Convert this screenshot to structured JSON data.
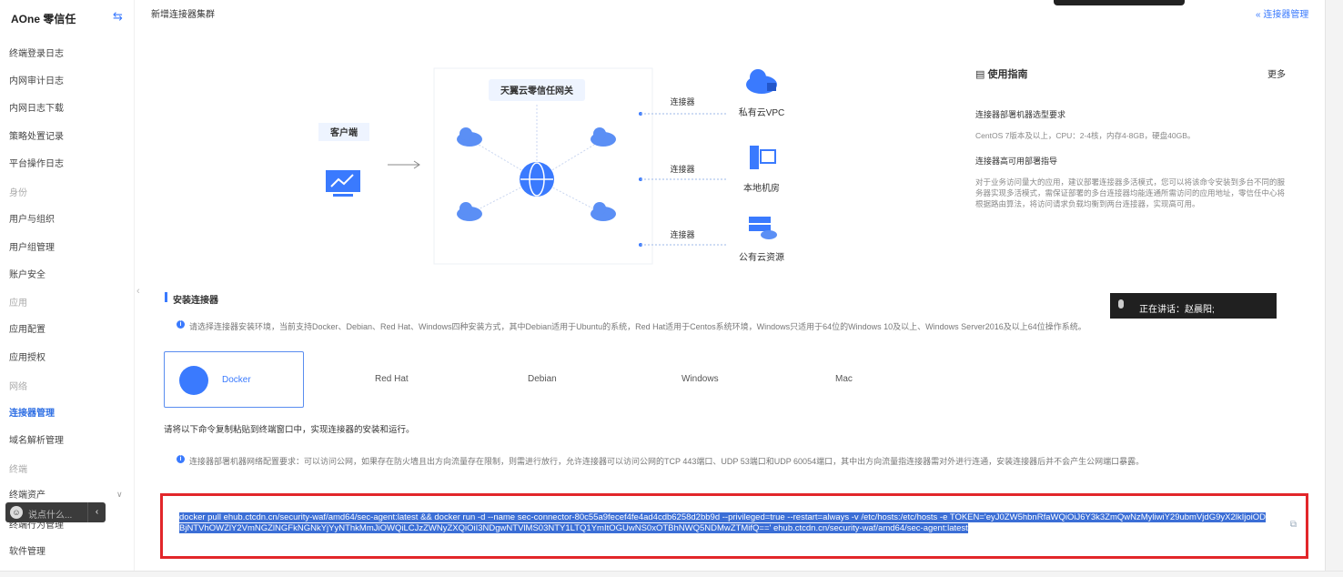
{
  "sidebar": {
    "brand": "AOne 零信任",
    "items": [
      {
        "label": "终端登录日志",
        "type": "item"
      },
      {
        "label": "内网审计日志",
        "type": "item"
      },
      {
        "label": "内网日志下载",
        "type": "item"
      },
      {
        "label": "策略处置记录",
        "type": "item"
      },
      {
        "label": "平台操作日志",
        "type": "item"
      },
      {
        "label": "身份",
        "type": "group"
      },
      {
        "label": "用户与组织",
        "type": "item"
      },
      {
        "label": "用户组管理",
        "type": "item"
      },
      {
        "label": "账户安全",
        "type": "item"
      },
      {
        "label": "应用",
        "type": "group"
      },
      {
        "label": "应用配置",
        "type": "item"
      },
      {
        "label": "应用授权",
        "type": "item"
      },
      {
        "label": "网络",
        "type": "group"
      },
      {
        "label": "连接器管理",
        "type": "active"
      },
      {
        "label": "域名解析管理",
        "type": "item"
      },
      {
        "label": "终端",
        "type": "group"
      },
      {
        "label": "终端资产",
        "type": "item"
      },
      {
        "label": "终端行为管理",
        "type": "item"
      },
      {
        "label": "软件管理",
        "type": "item"
      }
    ],
    "assist_placeholder": "说点什么..."
  },
  "header": {
    "title": "新增连接器集群",
    "breadcrumb": "« 连接器管理"
  },
  "diagram": {
    "client_label": "客户端",
    "gateway_label": "天翼云零信任网关",
    "connector_label": "连接器",
    "targets": [
      "私有云VPC",
      "本地机房",
      "公有云资源"
    ]
  },
  "guide": {
    "title": "使用指南",
    "more": "更多",
    "h1": "连接器部署机器选型要求",
    "p1": "CentOS 7版本及以上，CPU：2-4核，内存4-8GB，硬盘40GB。",
    "h2": "连接器高可用部署指导",
    "p2": "对于业务访问量大的应用，建议部署连接器多活模式，您可以将该命令安装到多台不同的服务器实现多活模式，需保证部署的多台连接器均能连通所需访问的应用地址，零信任中心将根据路由算法，将访问请求负载均衡到两台连接器，实现高可用。"
  },
  "install": {
    "section_title": "安装连接器",
    "env_info": "请选择连接器安装环境，当前支持Docker、Debian、Red Hat、Windows四种安装方式，其中Debian适用于Ubuntu的系统，Red Hat适用于Centos系统环境，Windows只适用于64位的Windows 10及以上、Windows Server2016及以上64位操作系统。",
    "tabs": [
      "Docker",
      "Red Hat",
      "Debian",
      "Windows",
      "Mac"
    ],
    "hint": "请将以下命令复制粘贴到终端窗口中，实现连接器的安装和运行。",
    "network_info": "连接器部署机器网络配置要求：可以访问公网，如果存在防火墙且出方向流量存在限制，则需进行放行，允许连接器可以访问公网的TCP 443端口、UDP 53端口和UDP 60054端口，其中出方向流量指连接器需对外进行连通，安装连接器后并不会产生公网端口暴露。",
    "command": "docker pull ehub.ctcdn.cn/security-waf/amd64/sec-agent:latest && docker run -d --name sec-connector-80c55a9fecef4fe4ad4cdb6258d2bb9d --privileged=true --restart=always -v /etc/hosts:/etc/hosts -e TOKEN='eyJ0ZW5hbnRfaWQiOiJ6Y3k3ZmQwNzMyliwiY29ubmVjdG9yX2lkIjoiODBjNTVhOWZlY2VmNGZlNGFkNGNkYjYyNThkMmJiOWQiLCJzZWNyZXQiOiI3NDgwNTVlMS03NTY1LTQ1YmItOGUwNS0xOTBhNWQ5NDMwZTMifQ==' ehub.ctcdn.cn/security-waf/amd64/sec-agent:latest"
  },
  "live": {
    "label": "正在讲话：赵晨阳;"
  }
}
